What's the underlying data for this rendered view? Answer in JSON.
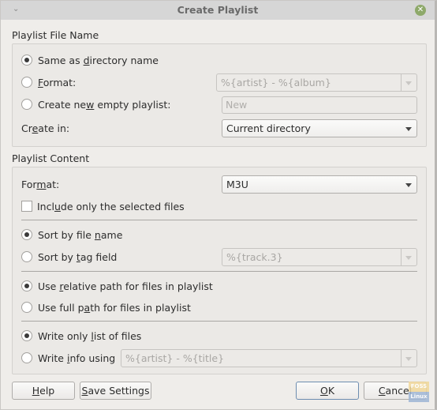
{
  "window": {
    "title": "Create Playlist",
    "menu_icon": "chevron-down-icon",
    "close_icon": "close-icon",
    "close_color": "#8ea96a"
  },
  "file_name": {
    "section_label": "Playlist File Name",
    "options": [
      {
        "label_pre": "Same as ",
        "label_u": "d",
        "label_post": "irectory name",
        "selected": true
      },
      {
        "label_pre": "",
        "label_u": "F",
        "label_post": "ormat:",
        "selected": false
      },
      {
        "label_pre": "Create ne",
        "label_u": "w",
        "label_post": " empty playlist:",
        "selected": false
      }
    ],
    "format_value": "%{artist} - %{album}",
    "new_placeholder": "New",
    "create_in": {
      "label_pre": "Cr",
      "label_u": "e",
      "label_post": "ate in:",
      "value": "Current directory"
    }
  },
  "content": {
    "section_label": "Playlist Content",
    "format": {
      "label_pre": "For",
      "label_u": "m",
      "label_post": "at:",
      "value": "M3U"
    },
    "include_selected": {
      "label_pre": "Incl",
      "label_u": "u",
      "label_post": "de only the selected files",
      "checked": false
    },
    "sort": [
      {
        "label_pre": "Sort by file ",
        "label_u": "n",
        "label_post": "ame",
        "selected": true
      },
      {
        "label_pre": "Sort by ",
        "label_u": "t",
        "label_post": "ag field",
        "selected": false
      }
    ],
    "tag_field_value": "%{track.3}",
    "path": [
      {
        "label_pre": "Use ",
        "label_u": "r",
        "label_post": "elative path for files in playlist",
        "selected": true
      },
      {
        "label_pre": "Use full p",
        "label_u": "a",
        "label_post": "th for files in playlist",
        "selected": false
      }
    ],
    "write": [
      {
        "label_pre": "Write only ",
        "label_u": "l",
        "label_post": "ist of files",
        "selected": true
      },
      {
        "label_pre": "Write ",
        "label_u": "i",
        "label_post": "nfo using",
        "selected": false
      }
    ],
    "info_value": "%{artist} - %{title}"
  },
  "buttons": {
    "help": {
      "u": "H",
      "rest": "elp"
    },
    "save_settings": {
      "u": "S",
      "rest": "ave Settings"
    },
    "ok": {
      "u": "O",
      "rest": "K"
    },
    "cancel": {
      "u": "C",
      "rest": "ancel"
    }
  },
  "watermark": {
    "line1": "FOSS",
    "line2": "Linux"
  }
}
